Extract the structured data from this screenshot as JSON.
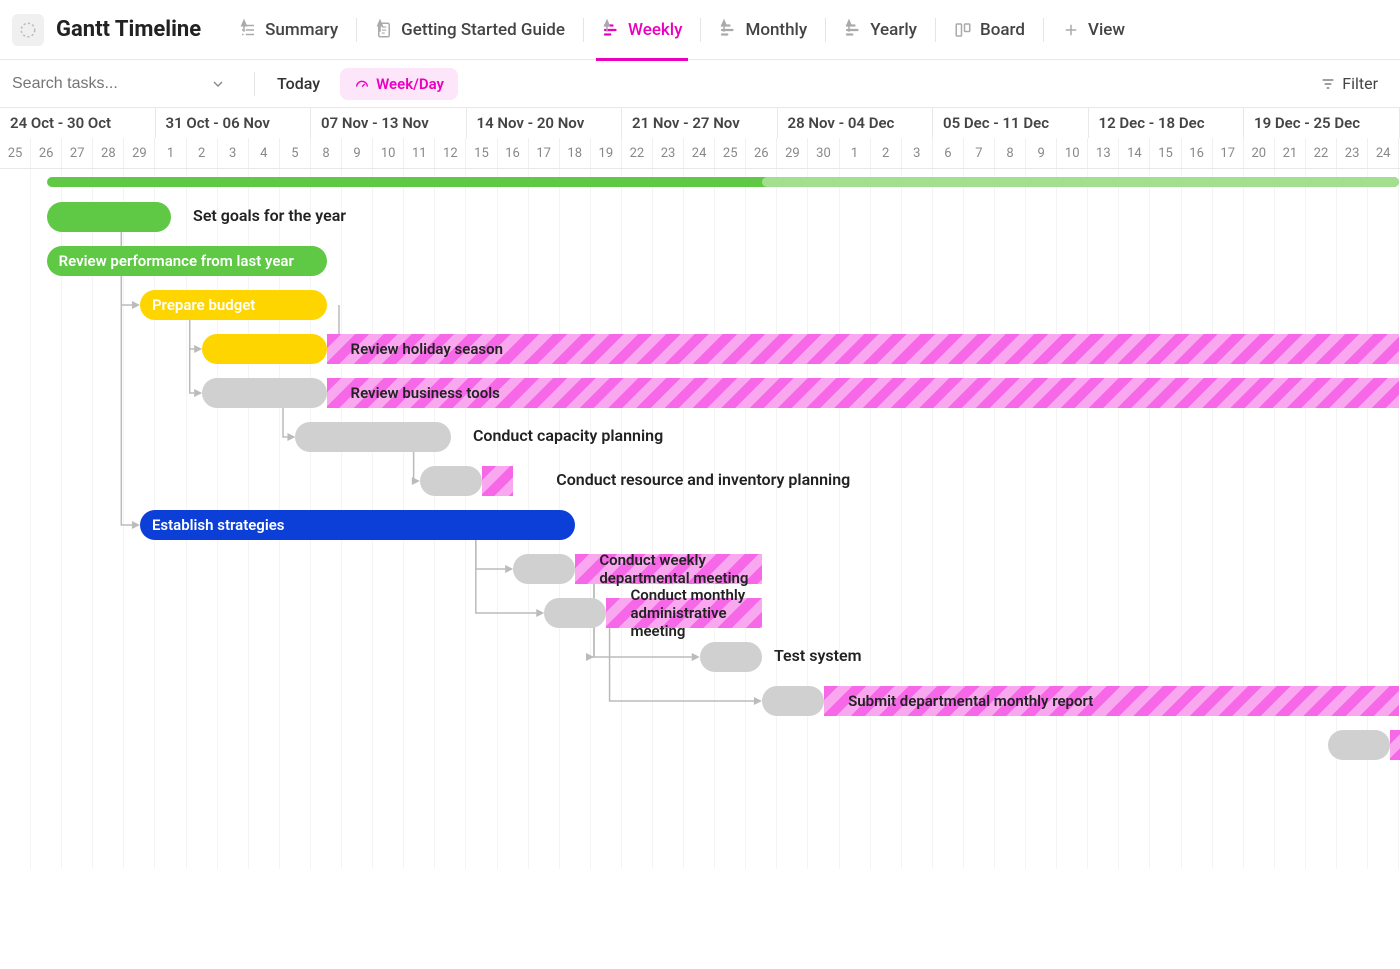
{
  "header": {
    "title": "Gantt Timeline",
    "tabs": [
      {
        "label": "Summary",
        "icon": "list"
      },
      {
        "label": "Getting Started Guide",
        "icon": "doc"
      },
      {
        "label": "Weekly",
        "icon": "gantt",
        "active": true
      },
      {
        "label": "Monthly",
        "icon": "gantt"
      },
      {
        "label": "Yearly",
        "icon": "gantt"
      },
      {
        "label": "Board",
        "icon": "board"
      },
      {
        "label": "View",
        "icon": "plus"
      }
    ]
  },
  "toolbar": {
    "search_placeholder": "Search tasks...",
    "today_label": "Today",
    "zoom_label": "Week/Day",
    "filter_label": "Filter"
  },
  "timeline": {
    "day_width": 31.1,
    "weeks": [
      {
        "label": "24 Oct - 30 Oct",
        "days": 5
      },
      {
        "label": "31 Oct - 06 Nov",
        "days": 5
      },
      {
        "label": "07 Nov - 13 Nov",
        "days": 5
      },
      {
        "label": "14 Nov - 20 Nov",
        "days": 5
      },
      {
        "label": "21 Nov - 27 Nov",
        "days": 5
      },
      {
        "label": "28 Nov - 04 Dec",
        "days": 5
      },
      {
        "label": "05 Dec - 11 Dec",
        "days": 5
      },
      {
        "label": "12 Dec - 18 Dec",
        "days": 5
      },
      {
        "label": "19 Dec - 25 Dec",
        "days": 5
      }
    ],
    "days": [
      "25",
      "26",
      "27",
      "28",
      "29",
      "1",
      "2",
      "3",
      "4",
      "5",
      "8",
      "9",
      "10",
      "11",
      "12",
      "15",
      "16",
      "17",
      "18",
      "19",
      "22",
      "23",
      "24",
      "25",
      "26",
      "29",
      "30",
      "1",
      "2",
      "3",
      "6",
      "7",
      "8",
      "9",
      "10",
      "13",
      "14",
      "15",
      "16",
      "17",
      "20",
      "21",
      "22",
      "23",
      "24"
    ]
  },
  "tasks": [
    {
      "row": 0,
      "type": "summary",
      "start": 1.5,
      "span": 43.5,
      "color": "green",
      "label": ""
    },
    {
      "row": 0,
      "type": "summary",
      "start": 24.5,
      "span": 20.5,
      "color": "green-light",
      "label": ""
    },
    {
      "row": 1,
      "start": 1.5,
      "span": 4,
      "color": "green",
      "label": "",
      "outside_label": "Set goals for the year"
    },
    {
      "row": 2,
      "start": 1.5,
      "span": 9,
      "color": "green",
      "label": "Review performance from last year"
    },
    {
      "row": 3,
      "start": 4.5,
      "span": 6,
      "color": "yellow",
      "label": "Prepare budget"
    },
    {
      "row": 4,
      "start": 6.5,
      "span": 4,
      "color": "yellow",
      "label": ""
    },
    {
      "row": 4,
      "start": 10.5,
      "span": 34.5,
      "color": "pink-stripe",
      "label": "Review holiday season"
    },
    {
      "row": 5,
      "start": 6.5,
      "span": 4,
      "color": "gray",
      "label": ""
    },
    {
      "row": 5,
      "start": 10.5,
      "span": 34.5,
      "color": "pink-stripe",
      "label": "Review business tools"
    },
    {
      "row": 6,
      "start": 9.5,
      "span": 5,
      "color": "gray",
      "label": "",
      "outside_label": "Conduct capacity planning"
    },
    {
      "row": 7,
      "start": 13.5,
      "span": 2,
      "color": "gray",
      "label": ""
    },
    {
      "row": 7,
      "start": 15.5,
      "span": 1,
      "color": "pink-stripe",
      "label": "",
      "outside_label": "Conduct resource and inventory planning"
    },
    {
      "row": 8,
      "start": 4.5,
      "span": 14,
      "color": "blue",
      "label": "Establish strategies"
    },
    {
      "row": 9,
      "start": 16.5,
      "span": 2,
      "color": "gray",
      "label": ""
    },
    {
      "row": 9,
      "start": 18.5,
      "span": 6,
      "color": "pink-stripe",
      "label": "Conduct weekly departmental meeting"
    },
    {
      "row": 10,
      "start": 17.5,
      "span": 2,
      "color": "gray",
      "label": ""
    },
    {
      "row": 10,
      "start": 19.5,
      "span": 5,
      "color": "pink-stripe",
      "label": "Conduct monthly administrative meeting"
    },
    {
      "row": 11,
      "start": 22.5,
      "span": 2,
      "color": "gray",
      "label": "",
      "outside_label": "Test system"
    },
    {
      "row": 12,
      "start": 24.5,
      "span": 2,
      "color": "gray",
      "label": ""
    },
    {
      "row": 12,
      "start": 26.5,
      "span": 18.5,
      "color": "pink-stripe",
      "label": "Submit departmental monthly report"
    },
    {
      "row": 13,
      "start": 42.7,
      "span": 2,
      "color": "gray",
      "label": ""
    },
    {
      "row": 13,
      "start": 44.7,
      "span": 0.5,
      "color": "pink-stripe",
      "label": ""
    }
  ],
  "colors": {
    "green": "#5fc845",
    "green_light": "#a2df8f",
    "yellow": "#ffd500",
    "blue": "#0b3fd8",
    "gray": "#d0d0d0",
    "pink": "#f768e8",
    "pink_light": "#f9a8f0",
    "accent": "#ec00c0"
  }
}
